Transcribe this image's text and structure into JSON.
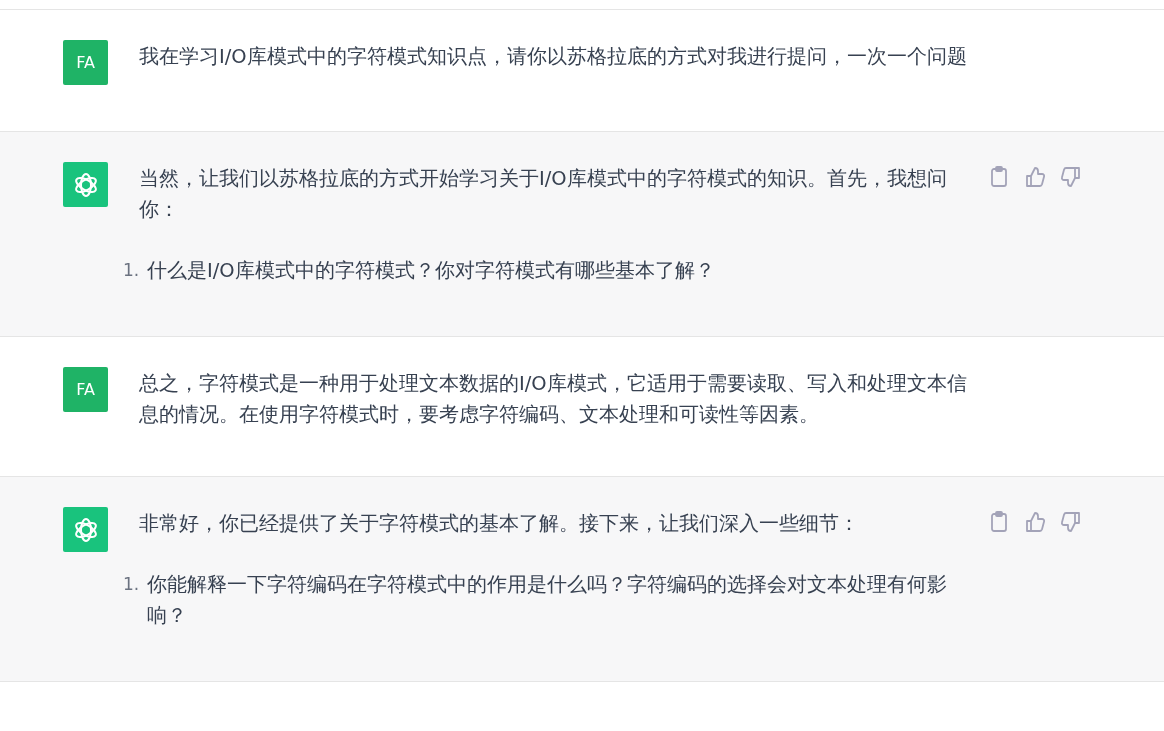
{
  "messages": [
    {
      "kind": "user",
      "avatar": "FA",
      "text": "我在学习I/O库模式中的字符模式知识点，请你以苏格拉底的方式对我进行提问，一次一个问题"
    },
    {
      "kind": "assistant",
      "text": "当然，让我们以苏格拉底的方式开始学习关于I/O库模式中的字符模式的知识。首先，我想问你：",
      "list": [
        {
          "number": "1.",
          "text": "什么是I/O库模式中的字符模式？你对字符模式有哪些基本了解？"
        }
      ]
    },
    {
      "kind": "user",
      "avatar": "FA",
      "text": "总之，字符模式是一种用于处理文本数据的I/O库模式，它适用于需要读取、写入和处理文本信息的情况。在使用字符模式时，要考虑字符编码、文本处理和可读性等因素。"
    },
    {
      "kind": "assistant",
      "text": "非常好，你已经提供了关于字符模式的基本了解。接下来，让我们深入一些细节：",
      "list": [
        {
          "number": "1.",
          "text": "你能解释一下字符编码在字符模式中的作用是什么吗？字符编码的选择会对文本处理有何影响？"
        }
      ]
    }
  ]
}
